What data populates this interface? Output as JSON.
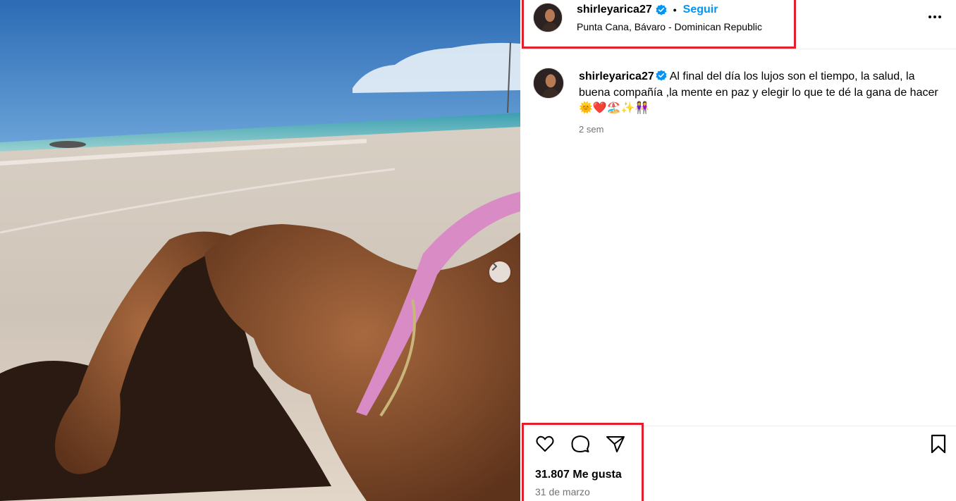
{
  "post": {
    "username": "shirleyarica27",
    "verified": true,
    "follow_label": "Seguir",
    "separator": "•",
    "location": "Punta Cana, Bávaro - Dominican Republic",
    "caption_text": "Al final del día los lujos son el tiempo, la salud, la buena compañía ,la mente en paz y elegir lo que te dé la gana de hacer 🌞❤️🏖️✨👭",
    "caption_time": "2 sem",
    "likes": "31.807 Me gusta",
    "date": "31 de marzo"
  },
  "icons": {
    "more": "more-options-icon",
    "verified": "verified-badge-icon",
    "like": "heart-icon",
    "comment": "comment-icon",
    "share": "send-icon",
    "save": "bookmark-icon",
    "carousel_next": "chevron-right-icon"
  },
  "colors": {
    "accent": "#0095f6",
    "verified": "#0095f6",
    "highlight": "#e0202c",
    "muted_text": "#737373"
  }
}
